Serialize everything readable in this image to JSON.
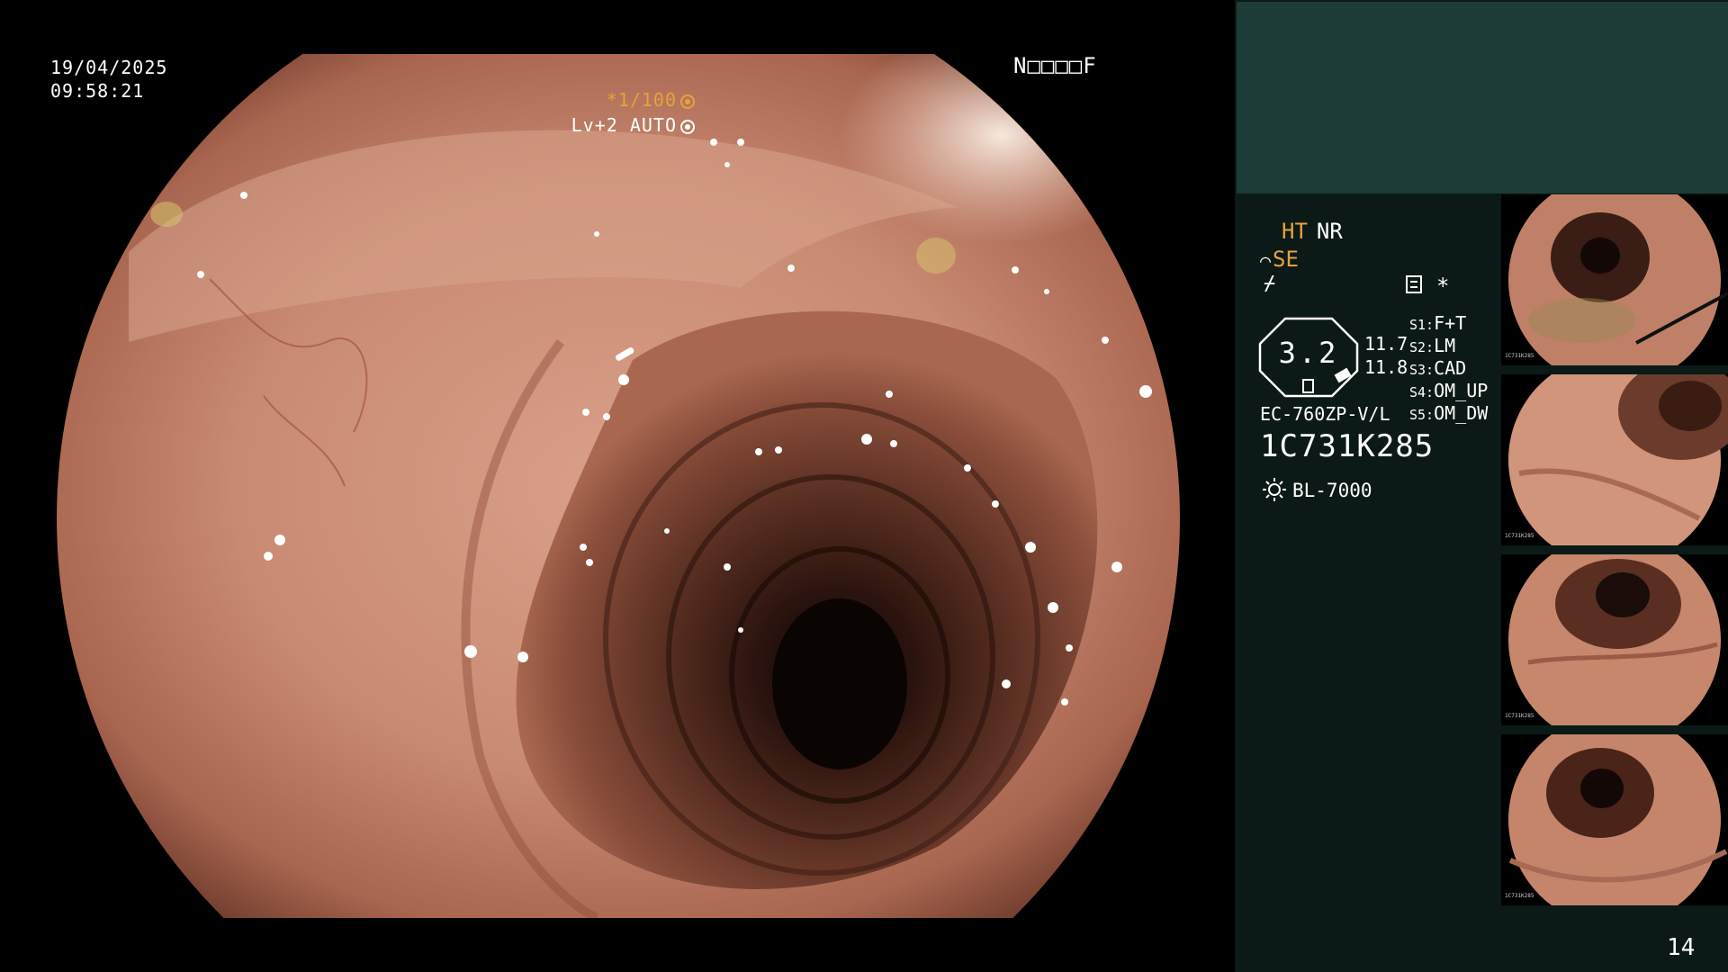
{
  "overlay": {
    "date": "19/04/2025",
    "time": "09:58:21",
    "status_code": "N□□□□F",
    "shutter": "*1/100",
    "level": "Lv+2 AUTO"
  },
  "panel": {
    "mode_ht": "HT",
    "mode_nr": "NR",
    "se_label": "SE",
    "scale_value": "3.2",
    "scale_num_1": "11.7",
    "scale_num_2": "11.8",
    "slots": [
      {
        "key": "S1:",
        "value": "F+T"
      },
      {
        "key": "S2:",
        "value": "LM"
      },
      {
        "key": "S3:",
        "value": "CAD"
      },
      {
        "key": "S4:",
        "value": "OM_UP"
      },
      {
        "key": "S5:",
        "value": "OM_DW"
      }
    ],
    "scope_model": "EC-760ZP-V/L",
    "serial": "1C731K285",
    "light_source": "BL-7000",
    "asterisk": "*",
    "frame_count": "14"
  },
  "thumbnails": [
    {
      "caption": "1C731K285"
    },
    {
      "caption": "1C731K285"
    },
    {
      "caption": "1C731K285"
    },
    {
      "caption": "1C731K285"
    }
  ],
  "colors": {
    "accent_orange": "#e8a23a",
    "panel_bg": "#0b1a17",
    "panel_top": "#1d3b37",
    "mucosa": "#c98a72"
  },
  "icons": [
    "shutter-icon",
    "auto-icon",
    "menu-icon",
    "lightning-icon",
    "light-source-icon"
  ]
}
